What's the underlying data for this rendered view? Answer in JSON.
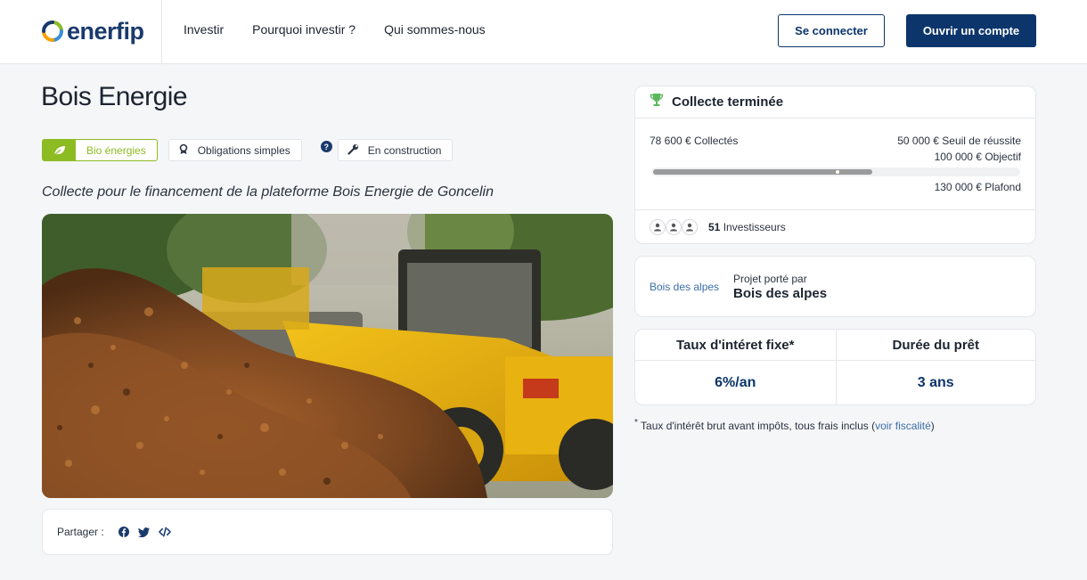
{
  "header": {
    "logo_text": "enerfip",
    "nav": [
      "Investir",
      "Pourquoi investir ?",
      "Qui sommes-nous"
    ],
    "login_label": "Se connecter",
    "open_account_label": "Ouvrir un compte"
  },
  "project": {
    "title": "Bois Energie",
    "tags": {
      "bio": "Bio énergies",
      "oblig": "Obligations simples",
      "help": "?",
      "construction": "En construction"
    },
    "subtitle": "Collecte pour le financement de la plateforme Bois Energie de Goncelin",
    "share_label": "Partager :"
  },
  "collect": {
    "status": "Collecte terminée",
    "collected": "78 600 € Collectés",
    "threshold": "50 000 € Seuil de réussite",
    "objective": "100 000 € Objectif",
    "ceiling": "130 000 € Plafond",
    "progress_fraction": 0.605,
    "objective_fraction": 0.769,
    "investors_count": "51",
    "investors_label": "Investisseurs"
  },
  "porteur": {
    "logo_text": "Bois des alpes",
    "label": "Projet porté par",
    "name": "Bois des alpes"
  },
  "rates": {
    "rate_label": "Taux d'intéret fixe*",
    "rate_value": "6%/an",
    "duration_label": "Durée du prêt",
    "duration_value": "3 ans"
  },
  "footnote": {
    "text": "Taux d'intérêt brut avant impôts, tous frais inclus (",
    "link": "voir fiscalité",
    "close": ")"
  },
  "colors": {
    "brand_navy": "#0c356b",
    "green": "#8dbb22",
    "trophy": "#5cb85c"
  },
  "icons": [
    "logo-mark-icon",
    "leaf-icon",
    "award-icon",
    "help-icon",
    "wrench-icon",
    "trophy-icon",
    "user-icon",
    "facebook-icon",
    "twitter-icon",
    "code-icon"
  ]
}
